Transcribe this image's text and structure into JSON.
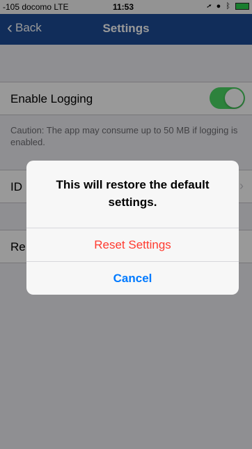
{
  "status_bar": {
    "carrier": "-105 docomo  LTE",
    "time": "11:53"
  },
  "nav": {
    "back_label": "Back",
    "title": "Settings"
  },
  "settings": {
    "enable_logging_label": "Enable Logging",
    "enable_logging_on": true,
    "caution_text": "Caution: The app may consume up to 50 MB if logging is enabled.",
    "id_row_label": "ID",
    "reset_row_label": "Re"
  },
  "alert": {
    "message": "This will restore the default settings.",
    "reset_label": "Reset Settings",
    "cancel_label": "Cancel"
  },
  "colors": {
    "nav_background": "#1d4c97",
    "toggle_on": "#4cd964",
    "destructive": "#ff3b30",
    "action": "#007aff"
  }
}
